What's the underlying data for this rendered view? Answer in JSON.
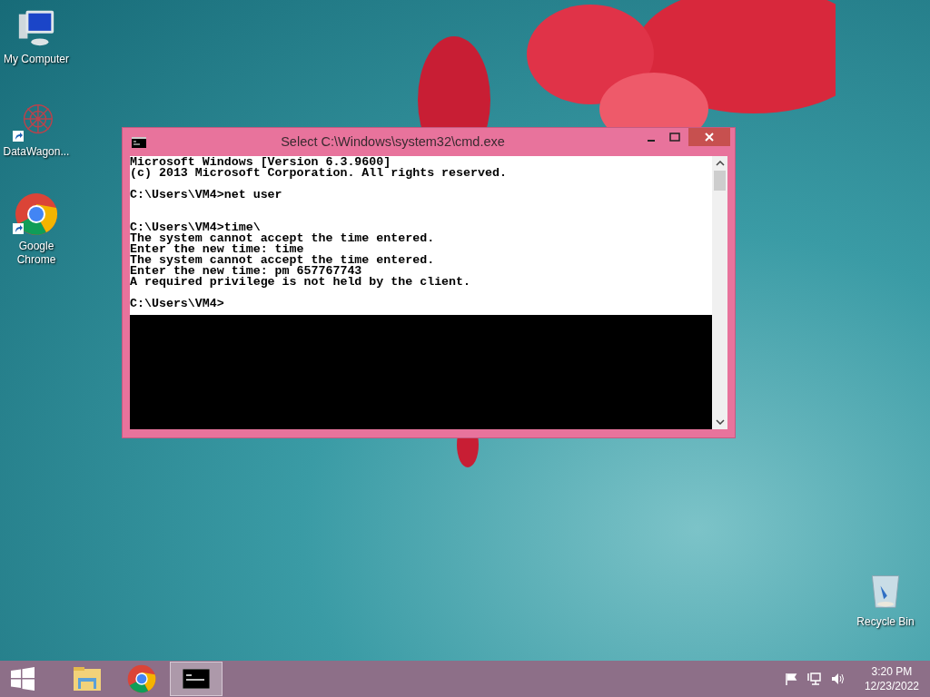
{
  "desktop_icons": [
    {
      "kind": "computer",
      "label": "My Computer",
      "shortcut": false
    },
    {
      "kind": "network",
      "label": "DataWagon...",
      "shortcut": true
    },
    {
      "kind": "chrome",
      "label": "Google Chrome",
      "shortcut": true
    },
    {
      "kind": "recycle",
      "label": "Recycle Bin",
      "shortcut": false
    }
  ],
  "window": {
    "title": "Select C:\\Windows\\system32\\cmd.exe",
    "console_blocks": [
      {
        "lines": [
          "Microsoft Windows [Version 6.3.9600]",
          "(c) 2013 Microsoft Corporation. All rights reserved."
        ],
        "double_gap": false
      },
      {
        "lines": [
          "C:\\Users\\VM4>net user"
        ],
        "double_gap": true
      },
      {
        "lines": [
          "C:\\Users\\VM4>time\\",
          "The system cannot accept the time entered.",
          "Enter the new time: time",
          "The system cannot accept the time entered.",
          "Enter the new time: pm 657767743",
          "A required privilege is not held by the client."
        ],
        "double_gap": false
      },
      {
        "lines": [
          "C:\\Users\\VM4>"
        ]
      }
    ]
  },
  "taskbar": {
    "apps": [
      {
        "kind": "explorer",
        "selected": false
      },
      {
        "kind": "chrome",
        "selected": false
      },
      {
        "kind": "cmd",
        "selected": true
      }
    ],
    "clock": {
      "time": "3:20 PM",
      "date": "12/23/2022"
    }
  }
}
